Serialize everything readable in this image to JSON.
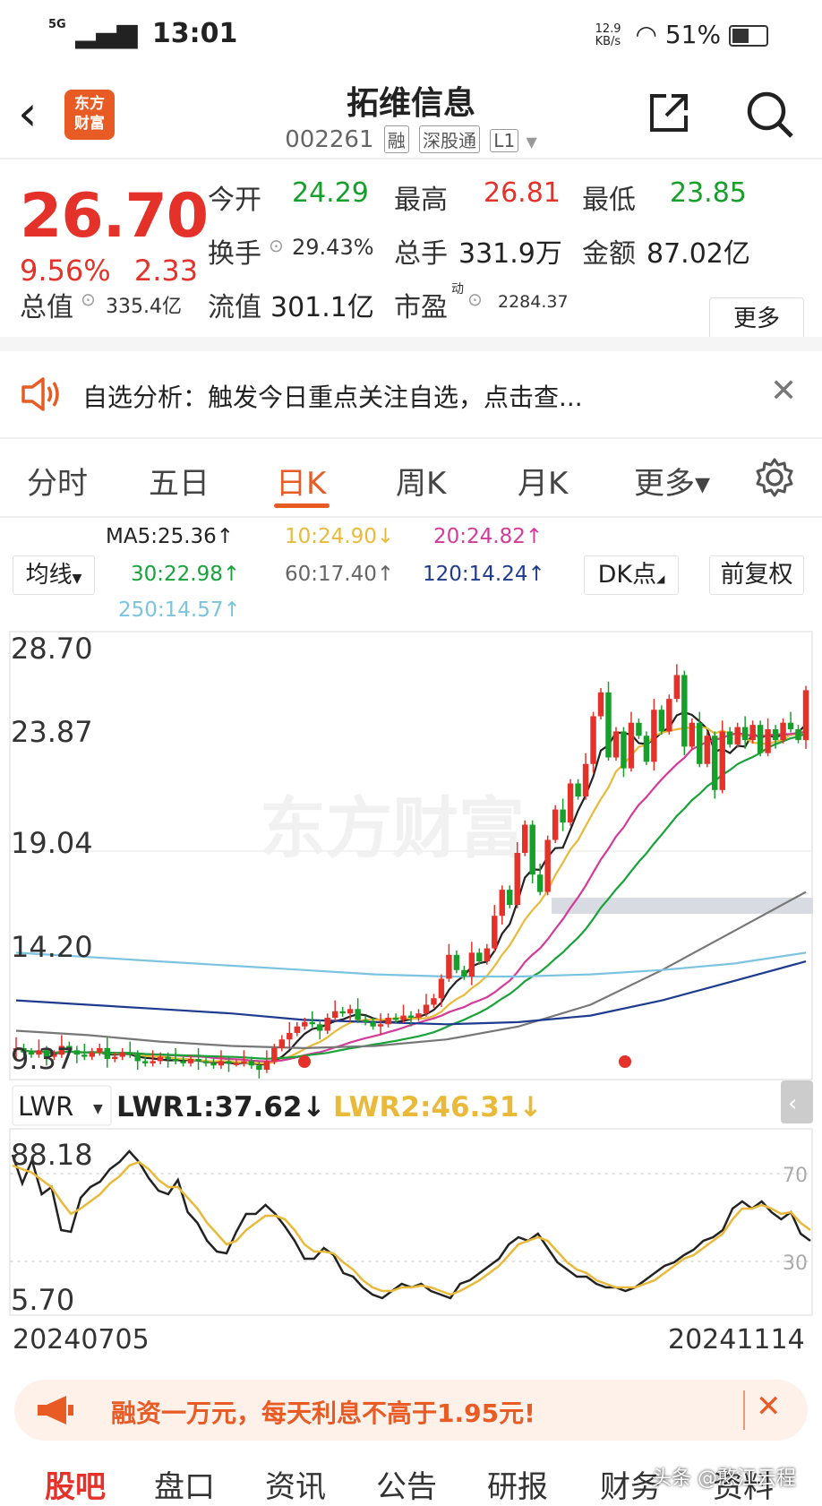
{
  "status_bar": {
    "network": "5G",
    "time": "13:01",
    "net_speed": "12.9 KB/s",
    "battery": "51%"
  },
  "header": {
    "logo_text_1": "东方",
    "logo_text_2": "财富",
    "stock_name": "拓维信息",
    "stock_code": "002261",
    "tags": [
      "融",
      "深股通",
      "L1"
    ]
  },
  "quote": {
    "price": "26.70",
    "change_pct": "9.56%",
    "change_amt": "2.33",
    "open_label": "今开",
    "open": "24.29",
    "high_label": "最高",
    "high": "26.81",
    "low_label": "最低",
    "low": "23.85",
    "turnover_label": "换手",
    "turnover": "29.43%",
    "volume_label": "总手",
    "volume": "331.9万",
    "amount_label": "金额",
    "amount": "87.02亿",
    "mktcap_label": "总值",
    "mktcap": "335.4亿",
    "float_label": "流值",
    "float": "301.1亿",
    "pe_label": "市盈",
    "pe_sup": "动",
    "pe": "2284.37",
    "more_label": "更多"
  },
  "notice": {
    "text": "自选分析：触发今日重点关注自选，点击查..."
  },
  "tabs": [
    {
      "label": "分时"
    },
    {
      "label": "五日"
    },
    {
      "label": "日K"
    },
    {
      "label": "周K"
    },
    {
      "label": "月K"
    },
    {
      "label": "更多▾"
    }
  ],
  "ma": {
    "selector": "均线",
    "ma5": "MA5:25.36↑",
    "ma10": "10:24.90↓",
    "ma20": "20:24.82↑",
    "ma30": "30:22.98↑",
    "ma60": "60:17.40↑",
    "ma120": "120:14.24↑",
    "ma250": "250:14.57↑",
    "dk_button": "DK点",
    "fq_button": "前复权"
  },
  "colors": {
    "up": "#e4322b",
    "down": "#16a02b",
    "accent": "#e85b24",
    "ma5": "#222222",
    "ma10": "#e9b93a",
    "ma20": "#d33a9a",
    "ma30": "#18a23a",
    "ma60": "#777777",
    "ma120": "#1e3b8f",
    "ma250": "#7cc3e0"
  },
  "chart_data": [
    {
      "type": "candlestick",
      "y_ticks": [
        "28.70",
        "23.87",
        "19.04",
        "14.20",
        "9.37"
      ],
      "ylim": [
        9.37,
        28.7
      ],
      "x_range": [
        "20240705",
        "20241114"
      ],
      "watermark": "东方财富",
      "closes": [
        10.2,
        10.0,
        9.9,
        10.1,
        9.8,
        9.9,
        10.3,
        10.1,
        9.9,
        9.8,
        10.0,
        10.2,
        9.7,
        9.8,
        10.0,
        9.9,
        9.6,
        9.5,
        9.6,
        9.8,
        9.7,
        9.6,
        9.5,
        9.7,
        9.6,
        9.5,
        9.4,
        9.6,
        9.5,
        9.5,
        9.6,
        9.4,
        9.2,
        9.6,
        10.2,
        10.6,
        10.9,
        11.2,
        11.4,
        11.3,
        11.0,
        11.6,
        11.9,
        11.8,
        12.0,
        11.5,
        11.4,
        11.2,
        11.3,
        11.6,
        11.5,
        11.7,
        11.6,
        11.8,
        12.2,
        12.5,
        13.4,
        14.5,
        13.8,
        13.5,
        14.6,
        14.2,
        14.8,
        16.3,
        17.5,
        16.8,
        19.2,
        20.5,
        18.2,
        17.4,
        19.8,
        21.2,
        20.6,
        22.4,
        21.8,
        23.3,
        25.5,
        26.6,
        23.6,
        24.8,
        23.1,
        25.2,
        24.6,
        23.4,
        25.8,
        24.8,
        26.3,
        27.4,
        24.1,
        25.2,
        23.3,
        24.6,
        22.1,
        24.8,
        24.2,
        25.0,
        24.4,
        25.1,
        23.8,
        24.9,
        24.4,
        25.2,
        24.9,
        24.4,
        26.7
      ],
      "ma_labels": [
        "MA5",
        "MA10",
        "MA20",
        "MA30",
        "MA60",
        "MA120",
        "MA250"
      ]
    },
    {
      "type": "line",
      "indicator": "LWR",
      "y_ticks": [
        "88.18",
        "5.70"
      ],
      "ref_levels": [
        "70",
        "30"
      ],
      "lwr1_label": "LWR1:37.62↓",
      "lwr2_label": "LWR2:46.31↓",
      "lwr1": [
        88,
        72,
        85,
        66,
        70,
        46,
        45,
        64,
        70,
        73,
        80,
        84,
        90,
        84,
        75,
        68,
        66,
        74,
        56,
        50,
        40,
        34,
        33,
        45,
        55,
        55,
        60,
        55,
        48,
        40,
        30,
        30,
        36,
        32,
        22,
        20,
        14,
        10,
        8,
        12,
        16,
        14,
        16,
        12,
        10,
        8,
        16,
        18,
        22,
        26,
        30,
        38,
        42,
        40,
        44,
        36,
        28,
        24,
        20,
        20,
        16,
        14,
        14,
        12,
        14,
        18,
        22,
        26,
        28,
        32,
        35,
        40,
        42,
        46,
        58,
        62,
        58,
        62,
        56,
        52,
        56,
        44,
        40
      ],
      "lwr2": [
        82,
        80,
        78,
        74,
        70,
        62,
        55,
        58,
        62,
        66,
        72,
        76,
        82,
        84,
        80,
        74,
        70,
        70,
        64,
        58,
        50,
        44,
        38,
        40,
        46,
        50,
        54,
        54,
        52,
        46,
        38,
        34,
        34,
        33,
        28,
        24,
        18,
        14,
        12,
        12,
        14,
        14,
        15,
        14,
        12,
        10,
        12,
        15,
        18,
        22,
        26,
        32,
        38,
        40,
        42,
        40,
        34,
        28,
        24,
        22,
        18,
        16,
        14,
        14,
        14,
        16,
        18,
        22,
        26,
        30,
        32,
        36,
        40,
        44,
        52,
        58,
        58,
        60,
        58,
        55,
        56,
        50,
        46
      ]
    }
  ],
  "promo": {
    "text": "融资一万元，每天利息不高于1.95元!"
  },
  "bottom_tabs": [
    {
      "label": "股吧"
    },
    {
      "label": "盘口"
    },
    {
      "label": "资讯"
    },
    {
      "label": "公告"
    },
    {
      "label": "研报"
    },
    {
      "label": "财务"
    },
    {
      "label": "资料"
    }
  ],
  "footer_watermark": "头条 @憨江云程"
}
